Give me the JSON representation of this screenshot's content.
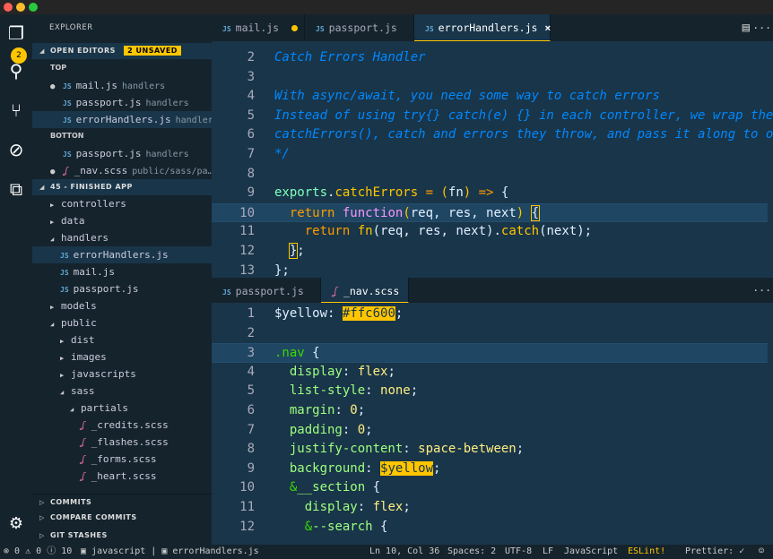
{
  "colors": {
    "accent": "#ffc600",
    "editor_bg": "#193549",
    "sidebar_bg": "#15232d"
  },
  "activity": {
    "explorer_badge": "2",
    "icons": [
      "files-icon",
      "search-icon",
      "source-control-icon",
      "debug-icon",
      "extensions-icon",
      "gear-icon"
    ]
  },
  "sidebar": {
    "title": "EXPLORER",
    "open_editors": {
      "label": "OPEN EDITORS",
      "badge": "2 UNSAVED",
      "groups": [
        {
          "label": "TOP",
          "items": [
            {
              "name": "mail.js",
              "dir": "handlers",
              "type": "js",
              "unsaved": true
            },
            {
              "name": "passport.js",
              "dir": "handlers",
              "type": "js"
            },
            {
              "name": "errorHandlers.js",
              "dir": "handler…",
              "type": "js",
              "selected": true
            }
          ]
        },
        {
          "label": "BOTTON",
          "items": [
            {
              "name": "passport.js",
              "dir": "handlers",
              "type": "js"
            },
            {
              "name": "_nav.scss",
              "dir": "public/sass/pa…",
              "type": "scss",
              "unsaved": true
            }
          ]
        }
      ]
    },
    "project": {
      "label": "45 - FINISHED APP",
      "tree": [
        {
          "name": "controllers",
          "depth": 0,
          "kind": "closed"
        },
        {
          "name": "data",
          "depth": 0,
          "kind": "closed"
        },
        {
          "name": "handlers",
          "depth": 0,
          "kind": "open"
        },
        {
          "name": "errorHandlers.js",
          "depth": 1,
          "kind": "js",
          "selected": true
        },
        {
          "name": "mail.js",
          "depth": 1,
          "kind": "js"
        },
        {
          "name": "passport.js",
          "depth": 1,
          "kind": "js"
        },
        {
          "name": "models",
          "depth": 0,
          "kind": "closed"
        },
        {
          "name": "public",
          "depth": 0,
          "kind": "open"
        },
        {
          "name": "dist",
          "depth": 1,
          "kind": "closed"
        },
        {
          "name": "images",
          "depth": 1,
          "kind": "closed"
        },
        {
          "name": "javascripts",
          "depth": 1,
          "kind": "closed"
        },
        {
          "name": "sass",
          "depth": 1,
          "kind": "open"
        },
        {
          "name": "partials",
          "depth": 2,
          "kind": "open"
        },
        {
          "name": "_credits.scss",
          "depth": 3,
          "kind": "scss"
        },
        {
          "name": "_flashes.scss",
          "depth": 3,
          "kind": "scss"
        },
        {
          "name": "_forms.scss",
          "depth": 3,
          "kind": "scss"
        },
        {
          "name": "_heart.scss",
          "depth": 3,
          "kind": "scss"
        }
      ]
    },
    "bottom_sections": [
      "COMMITS",
      "COMPARE COMMITS",
      "GIT STASHES"
    ]
  },
  "editor_top": {
    "tabs": [
      {
        "label": "mail.js",
        "type": "js",
        "unsaved": true
      },
      {
        "label": "passport.js",
        "type": "js"
      },
      {
        "label": "errorHandlers.js",
        "type": "js",
        "active": true,
        "close": "×"
      }
    ],
    "first_line": 2,
    "highlight_line": 10,
    "lines": [
      [
        [
          "Catch Errors Handler",
          "c"
        ]
      ],
      [],
      [
        [
          "With async/await, you need some way to catch errors",
          "c"
        ]
      ],
      [
        [
          "Instead of using try{} catch(e) {} in each controller, we wrap the function in",
          "c"
        ]
      ],
      [
        [
          "catchErrors(), catch and errors they throw, and pass it along to our express middleware with next()",
          "c"
        ]
      ],
      [
        [
          "*/",
          "c"
        ]
      ],
      [],
      [
        [
          "exports",
          "m"
        ],
        [
          ".",
          "w"
        ],
        [
          "catchErrors",
          "y"
        ],
        [
          " = ",
          "k"
        ],
        [
          "(",
          "y"
        ],
        [
          "fn",
          "w"
        ],
        [
          ")",
          "y"
        ],
        [
          " => ",
          "k"
        ],
        [
          "{",
          "w"
        ]
      ],
      [
        [
          "  "
        ],
        [
          "return ",
          "k"
        ],
        [
          "function",
          "f"
        ],
        [
          "(",
          "y"
        ],
        [
          "req, res, next",
          "w"
        ],
        [
          ")",
          "y"
        ],
        [
          " "
        ],
        [
          "{",
          "w br"
        ]
      ],
      [
        [
          "    "
        ],
        [
          "return ",
          "k"
        ],
        [
          "fn",
          "y"
        ],
        [
          "(",
          "w"
        ],
        [
          "req, res, next",
          "w"
        ],
        [
          ")",
          "w"
        ],
        [
          ".",
          "w"
        ],
        [
          "catch",
          "y"
        ],
        [
          "(next);",
          "w"
        ]
      ],
      [
        [
          "  "
        ],
        [
          "}",
          "w br"
        ],
        [
          ";",
          "w"
        ]
      ],
      [
        [
          "};",
          "w"
        ]
      ]
    ]
  },
  "editor_bottom": {
    "tabs": [
      {
        "label": "passport.js",
        "type": "js"
      },
      {
        "label": "_nav.scss",
        "type": "scss",
        "unsaved": true,
        "active": true
      }
    ],
    "first_line": 1,
    "highlight_line": 3,
    "lines": [
      [
        [
          "$yellow",
          "w"
        ],
        [
          ": ",
          "w"
        ],
        [
          "#ffc600",
          "hy"
        ],
        [
          ";",
          "w"
        ]
      ],
      [],
      [
        [
          ".nav",
          "s"
        ],
        [
          " {",
          "w"
        ]
      ],
      [
        [
          "  "
        ],
        [
          "display",
          "p"
        ],
        [
          ": ",
          "w"
        ],
        [
          "flex",
          "v"
        ],
        [
          ";",
          "w"
        ]
      ],
      [
        [
          "  "
        ],
        [
          "list-style",
          "p"
        ],
        [
          ": ",
          "w"
        ],
        [
          "none",
          "v"
        ],
        [
          ";",
          "w"
        ]
      ],
      [
        [
          "  "
        ],
        [
          "margin",
          "p"
        ],
        [
          ": ",
          "w"
        ],
        [
          "0",
          "v"
        ],
        [
          ";",
          "w"
        ]
      ],
      [
        [
          "  "
        ],
        [
          "padding",
          "p"
        ],
        [
          ": ",
          "w"
        ],
        [
          "0",
          "v"
        ],
        [
          ";",
          "w"
        ]
      ],
      [
        [
          "  "
        ],
        [
          "justify-content",
          "p"
        ],
        [
          ": ",
          "w"
        ],
        [
          "space-between",
          "v"
        ],
        [
          ";",
          "w"
        ]
      ],
      [
        [
          "  "
        ],
        [
          "background",
          "p"
        ],
        [
          ": ",
          "w"
        ],
        [
          "$yellow",
          "hy"
        ],
        [
          ";",
          "w"
        ]
      ],
      [
        [
          "  "
        ],
        [
          "&",
          "s"
        ],
        [
          "__section",
          "p"
        ],
        [
          " {",
          "w"
        ]
      ],
      [
        [
          "    "
        ],
        [
          "display",
          "p"
        ],
        [
          ": ",
          "w"
        ],
        [
          "flex",
          "v"
        ],
        [
          ";",
          "w"
        ]
      ],
      [
        [
          "    "
        ],
        [
          "&",
          "s"
        ],
        [
          "--search",
          "p"
        ],
        [
          " {",
          "w"
        ]
      ]
    ]
  },
  "status": {
    "errors": "0",
    "warnings": "0",
    "info": "10",
    "language_scope": "javascript",
    "file": "errorHandlers.js",
    "position": "Ln 10, Col 36",
    "spaces": "Spaces: 2",
    "encoding": "UTF-8",
    "eol": "LF",
    "language": "JavaScript",
    "eslint": "ESLint!",
    "prettier": "Prettier: ✓"
  }
}
